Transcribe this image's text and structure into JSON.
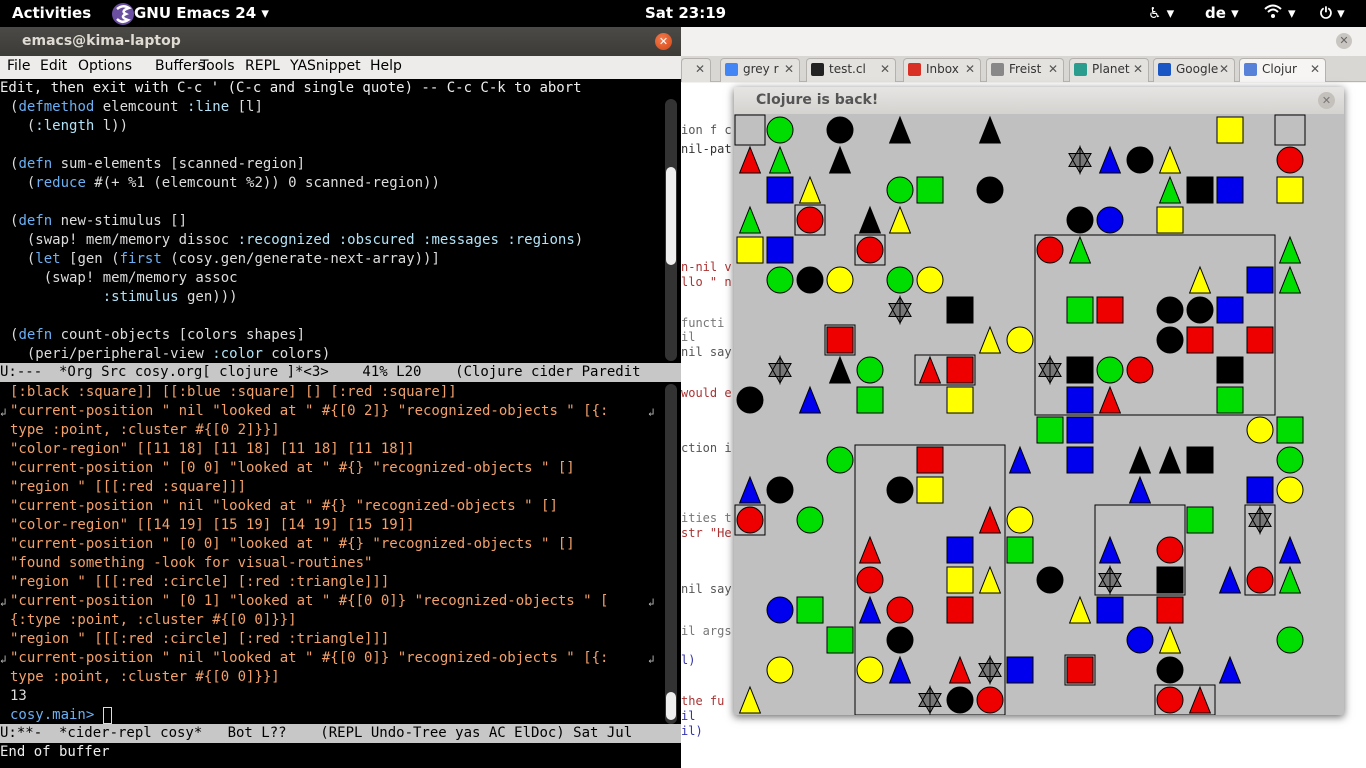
{
  "topbar": {
    "activities": "Activities",
    "app_menu": "GNU Emacs 24",
    "clock": "Sat 23:19",
    "keyboard": "de"
  },
  "emacs": {
    "window_title": "emacs@kima-laptop",
    "menu": [
      "File",
      "Edit",
      "Options",
      "Buffers",
      "Tools",
      "REPL",
      "YASnippet",
      "Help"
    ],
    "header_line": "Edit, then exit with C-c ' (C-c and single quote) -- C-c C-k to abort",
    "top_modeline": "U:---  *Org Src cosy.org[ clojure ]*<3>    41% L20    (Clojure cider Paredit",
    "bottom_modeline": "U:**-  *cider-repl cosy*   Bot L??    (REPL Undo-Tree yas AC ElDoc) Sat Jul",
    "echo_area": "End of buffer",
    "code_lines": [
      "(defmethod elemcount :line [l]",
      "  (:length l))",
      "",
      "(defn sum-elements [scanned-region]",
      "  (reduce #(+ %1 (elemcount %2)) 0 scanned-region))",
      "",
      "(defn new-stimulus []",
      "  (swap! mem/memory dissoc :recognized :obscured :messages :regions)",
      "  (let [gen (first (cosy.gen/generate-next-array))]",
      "    (swap! mem/memory assoc",
      "           :stimulus gen)))",
      "",
      "(defn count-objects [colors shapes]",
      "  (peri/peripheral-view :color colors)"
    ],
    "repl_lines": [
      "[:black :square]] [[:blue :square] [] [:red :square]]",
      "\"current-position \" nil \"looked at \" #{[0 2]} \"recognized-objects \" [{:",
      "type :point, :cluster #{[0 2]}}]",
      "\"color-region\" [[11 18] [11 18] [11 18] [11 18]]",
      "\"current-position \" [0 0] \"looked at \" #{} \"recognized-objects \" []",
      "\"region \" [[[:red :square]]]",
      "\"current-position \" nil \"looked at \" #{} \"recognized-objects \" []",
      "\"color-region\" [[14 19] [15 19] [14 19] [15 19]]",
      "\"current-position \" [0 0] \"looked at \" #{} \"recognized-objects \" []",
      "\"found something -look for visual-routines\"",
      "\"region \" [[[:red :circle] [:red :triangle]]]",
      "\"current-position \" [0 1] \"looked at \" #{[0 0]} \"recognized-objects \" [",
      "{:type :point, :cluster #{[0 0]}}]",
      "\"region \" [[[:red :circle] [:red :triangle]]]",
      "\"current-position \" nil \"looked at \" #{[0 0]} \"recognized-objects \" [{:",
      "type :point, :cluster #{[0 0]}}]",
      "13",
      "cosy.main> "
    ]
  },
  "browser": {
    "tabs": [
      {
        "label": "",
        "color": "#7a7a7a"
      },
      {
        "label": "grey r",
        "color": "#4285f4",
        "icon": "g-icon"
      },
      {
        "label": "test.cl",
        "color": "#222222",
        "icon": "github-icon"
      },
      {
        "label": "Inbox",
        "color": "#d93025",
        "icon": "gmail-icon"
      },
      {
        "label": "Freist",
        "color": "#888888",
        "icon": "page-icon"
      },
      {
        "label": "Planet",
        "color": "#2a9d8f",
        "icon": "planet-icon"
      },
      {
        "label": "Google",
        "color": "#1a56c4",
        "icon": "google-icon"
      },
      {
        "label": "Clojur",
        "color": "#5881d8",
        "icon": "clojure-icon"
      }
    ],
    "page_fragments": [
      "ion f c",
      "nil-pat",
      "n-nil v",
      "llo \" n",
      "functi",
      "il",
      "nil say",
      "would e",
      "ction i",
      "ities t",
      "str \"He",
      "nil say",
      "il args",
      "l)",
      "the fu",
      "il",
      "il)"
    ]
  },
  "clojure_window": {
    "title": "Clojure is back!",
    "colors": {
      "red": "#ee0000",
      "green": "#00dd00",
      "blue": "#0000ee",
      "yellow": "#ffff00",
      "black": "#000000",
      "grey": "#777777",
      "bg": "#c0c0c0"
    },
    "regions": [
      {
        "c": 0,
        "r": 0,
        "w": 1,
        "h": 1
      },
      {
        "c": 2,
        "r": 3,
        "w": 1,
        "h": 1
      },
      {
        "c": 4,
        "r": 4,
        "w": 1,
        "h": 1
      },
      {
        "c": 3,
        "r": 7,
        "w": 1,
        "h": 1
      },
      {
        "c": 6,
        "r": 8,
        "w": 2,
        "h": 1
      },
      {
        "c": 10,
        "r": 4,
        "w": 8,
        "h": 6
      },
      {
        "c": 18,
        "r": 0,
        "w": 1,
        "h": 1
      },
      {
        "c": 4,
        "r": 11,
        "w": 5,
        "h": 9
      },
      {
        "c": 12,
        "r": 13,
        "w": 3,
        "h": 3
      },
      {
        "c": 17,
        "r": 13,
        "w": 1,
        "h": 3
      },
      {
        "c": 0,
        "r": 13,
        "w": 1,
        "h": 1
      },
      {
        "c": 11,
        "r": 18,
        "w": 1,
        "h": 1
      },
      {
        "c": 14,
        "r": 19,
        "w": 2,
        "h": 1
      }
    ],
    "shapes": [
      {
        "s": "circle",
        "k": "green",
        "c": 1,
        "r": 0
      },
      {
        "s": "circle",
        "k": "black",
        "c": 3,
        "r": 0
      },
      {
        "s": "triangle",
        "k": "black",
        "c": 5,
        "r": 0
      },
      {
        "s": "triangle",
        "k": "black",
        "c": 8,
        "r": 0
      },
      {
        "s": "square",
        "k": "yellow",
        "c": 16,
        "r": 0
      },
      {
        "s": "triangle",
        "k": "red",
        "c": 0,
        "r": 1
      },
      {
        "s": "triangle",
        "k": "green",
        "c": 1,
        "r": 1
      },
      {
        "s": "triangle",
        "k": "black",
        "c": 3,
        "r": 1
      },
      {
        "s": "star",
        "k": "grey",
        "c": 11,
        "r": 1
      },
      {
        "s": "triangle",
        "k": "blue",
        "c": 12,
        "r": 1
      },
      {
        "s": "circle",
        "k": "black",
        "c": 13,
        "r": 1
      },
      {
        "s": "triangle",
        "k": "yellow",
        "c": 14,
        "r": 1
      },
      {
        "s": "circle",
        "k": "red",
        "c": 18,
        "r": 1
      },
      {
        "s": "square",
        "k": "blue",
        "c": 1,
        "r": 2
      },
      {
        "s": "triangle",
        "k": "yellow",
        "c": 2,
        "r": 2
      },
      {
        "s": "circle",
        "k": "green",
        "c": 5,
        "r": 2
      },
      {
        "s": "square",
        "k": "green",
        "c": 6,
        "r": 2
      },
      {
        "s": "circle",
        "k": "black",
        "c": 8,
        "r": 2
      },
      {
        "s": "triangle",
        "k": "green",
        "c": 14,
        "r": 2
      },
      {
        "s": "square",
        "k": "black",
        "c": 15,
        "r": 2
      },
      {
        "s": "square",
        "k": "blue",
        "c": 16,
        "r": 2
      },
      {
        "s": "square",
        "k": "yellow",
        "c": 18,
        "r": 2
      },
      {
        "s": "triangle",
        "k": "green",
        "c": 0,
        "r": 3
      },
      {
        "s": "circle",
        "k": "red",
        "c": 2,
        "r": 3
      },
      {
        "s": "triangle",
        "k": "black",
        "c": 4,
        "r": 3
      },
      {
        "s": "triangle",
        "k": "yellow",
        "c": 5,
        "r": 3
      },
      {
        "s": "circle",
        "k": "black",
        "c": 11,
        "r": 3
      },
      {
        "s": "circle",
        "k": "blue",
        "c": 12,
        "r": 3
      },
      {
        "s": "square",
        "k": "yellow",
        "c": 14,
        "r": 3
      },
      {
        "s": "square",
        "k": "yellow",
        "c": 0,
        "r": 4
      },
      {
        "s": "square",
        "k": "blue",
        "c": 1,
        "r": 4
      },
      {
        "s": "circle",
        "k": "red",
        "c": 4,
        "r": 4
      },
      {
        "s": "circle",
        "k": "red",
        "c": 10,
        "r": 4
      },
      {
        "s": "triangle",
        "k": "green",
        "c": 11,
        "r": 4
      },
      {
        "s": "triangle",
        "k": "green",
        "c": 18,
        "r": 4
      },
      {
        "s": "circle",
        "k": "green",
        "c": 1,
        "r": 5
      },
      {
        "s": "circle",
        "k": "black",
        "c": 2,
        "r": 5
      },
      {
        "s": "circle",
        "k": "yellow",
        "c": 3,
        "r": 5
      },
      {
        "s": "circle",
        "k": "green",
        "c": 5,
        "r": 5
      },
      {
        "s": "circle",
        "k": "yellow",
        "c": 6,
        "r": 5
      },
      {
        "s": "triangle",
        "k": "yellow",
        "c": 15,
        "r": 5
      },
      {
        "s": "square",
        "k": "blue",
        "c": 17,
        "r": 5
      },
      {
        "s": "triangle",
        "k": "green",
        "c": 18,
        "r": 5
      },
      {
        "s": "star",
        "k": "grey",
        "c": 5,
        "r": 6
      },
      {
        "s": "square",
        "k": "black",
        "c": 7,
        "r": 6
      },
      {
        "s": "square",
        "k": "green",
        "c": 11,
        "r": 6
      },
      {
        "s": "square",
        "k": "red",
        "c": 12,
        "r": 6
      },
      {
        "s": "circle",
        "k": "black",
        "c": 14,
        "r": 6
      },
      {
        "s": "circle",
        "k": "black",
        "c": 15,
        "r": 6
      },
      {
        "s": "square",
        "k": "blue",
        "c": 16,
        "r": 6
      },
      {
        "s": "square",
        "k": "red",
        "c": 3,
        "r": 7
      },
      {
        "s": "triangle",
        "k": "yellow",
        "c": 8,
        "r": 7
      },
      {
        "s": "circle",
        "k": "yellow",
        "c": 9,
        "r": 7
      },
      {
        "s": "circle",
        "k": "black",
        "c": 14,
        "r": 7
      },
      {
        "s": "square",
        "k": "red",
        "c": 15,
        "r": 7
      },
      {
        "s": "square",
        "k": "red",
        "c": 17,
        "r": 7
      },
      {
        "s": "star",
        "k": "grey",
        "c": 1,
        "r": 8
      },
      {
        "s": "triangle",
        "k": "black",
        "c": 3,
        "r": 8
      },
      {
        "s": "circle",
        "k": "green",
        "c": 4,
        "r": 8
      },
      {
        "s": "triangle",
        "k": "red",
        "c": 6,
        "r": 8
      },
      {
        "s": "square",
        "k": "red",
        "c": 7,
        "r": 8
      },
      {
        "s": "star",
        "k": "grey",
        "c": 10,
        "r": 8
      },
      {
        "s": "square",
        "k": "black",
        "c": 11,
        "r": 8
      },
      {
        "s": "circle",
        "k": "green",
        "c": 12,
        "r": 8
      },
      {
        "s": "circle",
        "k": "red",
        "c": 13,
        "r": 8
      },
      {
        "s": "square",
        "k": "black",
        "c": 16,
        "r": 8
      },
      {
        "s": "circle",
        "k": "black",
        "c": 0,
        "r": 9
      },
      {
        "s": "triangle",
        "k": "blue",
        "c": 2,
        "r": 9
      },
      {
        "s": "square",
        "k": "green",
        "c": 4,
        "r": 9
      },
      {
        "s": "square",
        "k": "yellow",
        "c": 7,
        "r": 9
      },
      {
        "s": "square",
        "k": "blue",
        "c": 11,
        "r": 9
      },
      {
        "s": "triangle",
        "k": "red",
        "c": 12,
        "r": 9
      },
      {
        "s": "square",
        "k": "green",
        "c": 16,
        "r": 9
      },
      {
        "s": "square",
        "k": "green",
        "c": 10,
        "r": 10
      },
      {
        "s": "square",
        "k": "blue",
        "c": 11,
        "r": 10
      },
      {
        "s": "circle",
        "k": "yellow",
        "c": 17,
        "r": 10
      },
      {
        "s": "square",
        "k": "green",
        "c": 18,
        "r": 10
      },
      {
        "s": "circle",
        "k": "green",
        "c": 3,
        "r": 11
      },
      {
        "s": "square",
        "k": "red",
        "c": 6,
        "r": 11
      },
      {
        "s": "triangle",
        "k": "blue",
        "c": 9,
        "r": 11
      },
      {
        "s": "square",
        "k": "blue",
        "c": 11,
        "r": 11
      },
      {
        "s": "triangle",
        "k": "black",
        "c": 13,
        "r": 11
      },
      {
        "s": "triangle",
        "k": "black",
        "c": 14,
        "r": 11
      },
      {
        "s": "square",
        "k": "black",
        "c": 15,
        "r": 11
      },
      {
        "s": "circle",
        "k": "green",
        "c": 18,
        "r": 11
      },
      {
        "s": "triangle",
        "k": "blue",
        "c": 0,
        "r": 12
      },
      {
        "s": "circle",
        "k": "black",
        "c": 1,
        "r": 12
      },
      {
        "s": "circle",
        "k": "black",
        "c": 5,
        "r": 12
      },
      {
        "s": "square",
        "k": "yellow",
        "c": 6,
        "r": 12
      },
      {
        "s": "triangle",
        "k": "blue",
        "c": 13,
        "r": 12
      },
      {
        "s": "square",
        "k": "blue",
        "c": 17,
        "r": 12
      },
      {
        "s": "circle",
        "k": "yellow",
        "c": 18,
        "r": 12
      },
      {
        "s": "circle",
        "k": "red",
        "c": 0,
        "r": 13
      },
      {
        "s": "circle",
        "k": "green",
        "c": 2,
        "r": 13
      },
      {
        "s": "triangle",
        "k": "red",
        "c": 8,
        "r": 13
      },
      {
        "s": "circle",
        "k": "yellow",
        "c": 9,
        "r": 13
      },
      {
        "s": "square",
        "k": "green",
        "c": 15,
        "r": 13
      },
      {
        "s": "star",
        "k": "grey",
        "c": 17,
        "r": 13
      },
      {
        "s": "triangle",
        "k": "red",
        "c": 4,
        "r": 14
      },
      {
        "s": "square",
        "k": "blue",
        "c": 7,
        "r": 14
      },
      {
        "s": "square",
        "k": "green",
        "c": 9,
        "r": 14
      },
      {
        "s": "triangle",
        "k": "blue",
        "c": 12,
        "r": 14
      },
      {
        "s": "circle",
        "k": "red",
        "c": 14,
        "r": 14
      },
      {
        "s": "triangle",
        "k": "blue",
        "c": 18,
        "r": 14
      },
      {
        "s": "circle",
        "k": "red",
        "c": 4,
        "r": 15
      },
      {
        "s": "square",
        "k": "yellow",
        "c": 7,
        "r": 15
      },
      {
        "s": "triangle",
        "k": "yellow",
        "c": 8,
        "r": 15
      },
      {
        "s": "circle",
        "k": "black",
        "c": 10,
        "r": 15
      },
      {
        "s": "star",
        "k": "grey",
        "c": 12,
        "r": 15
      },
      {
        "s": "square",
        "k": "black",
        "c": 14,
        "r": 15
      },
      {
        "s": "triangle",
        "k": "blue",
        "c": 16,
        "r": 15
      },
      {
        "s": "circle",
        "k": "red",
        "c": 17,
        "r": 15
      },
      {
        "s": "triangle",
        "k": "green",
        "c": 18,
        "r": 15
      },
      {
        "s": "circle",
        "k": "blue",
        "c": 1,
        "r": 16
      },
      {
        "s": "square",
        "k": "green",
        "c": 2,
        "r": 16
      },
      {
        "s": "triangle",
        "k": "blue",
        "c": 4,
        "r": 16
      },
      {
        "s": "circle",
        "k": "red",
        "c": 5,
        "r": 16
      },
      {
        "s": "square",
        "k": "red",
        "c": 7,
        "r": 16
      },
      {
        "s": "triangle",
        "k": "yellow",
        "c": 11,
        "r": 16
      },
      {
        "s": "square",
        "k": "blue",
        "c": 12,
        "r": 16
      },
      {
        "s": "square",
        "k": "red",
        "c": 14,
        "r": 16
      },
      {
        "s": "square",
        "k": "green",
        "c": 3,
        "r": 17
      },
      {
        "s": "circle",
        "k": "black",
        "c": 5,
        "r": 17
      },
      {
        "s": "circle",
        "k": "blue",
        "c": 13,
        "r": 17
      },
      {
        "s": "triangle",
        "k": "yellow",
        "c": 14,
        "r": 17
      },
      {
        "s": "circle",
        "k": "green",
        "c": 18,
        "r": 17
      },
      {
        "s": "circle",
        "k": "yellow",
        "c": 1,
        "r": 18
      },
      {
        "s": "circle",
        "k": "yellow",
        "c": 4,
        "r": 18
      },
      {
        "s": "triangle",
        "k": "blue",
        "c": 5,
        "r": 18
      },
      {
        "s": "triangle",
        "k": "red",
        "c": 7,
        "r": 18
      },
      {
        "s": "star",
        "k": "grey",
        "c": 8,
        "r": 18
      },
      {
        "s": "square",
        "k": "blue",
        "c": 9,
        "r": 18
      },
      {
        "s": "square",
        "k": "red",
        "c": 11,
        "r": 18
      },
      {
        "s": "circle",
        "k": "black",
        "c": 14,
        "r": 18
      },
      {
        "s": "triangle",
        "k": "blue",
        "c": 16,
        "r": 18
      },
      {
        "s": "triangle",
        "k": "yellow",
        "c": 0,
        "r": 19
      },
      {
        "s": "star",
        "k": "grey",
        "c": 6,
        "r": 19
      },
      {
        "s": "circle",
        "k": "black",
        "c": 7,
        "r": 19
      },
      {
        "s": "circle",
        "k": "red",
        "c": 8,
        "r": 19
      },
      {
        "s": "circle",
        "k": "red",
        "c": 14,
        "r": 19
      },
      {
        "s": "triangle",
        "k": "red",
        "c": 15,
        "r": 19
      }
    ]
  }
}
